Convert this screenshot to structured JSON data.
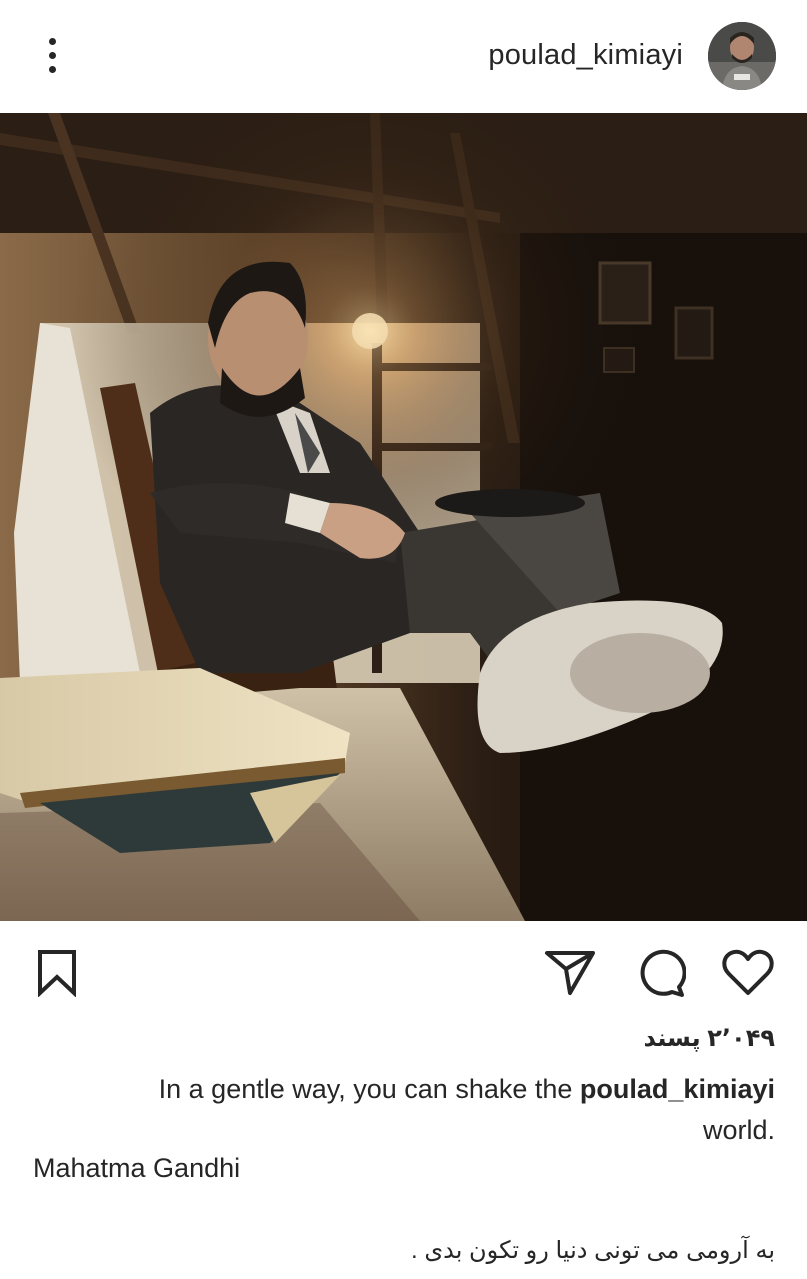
{
  "post": {
    "username": "poulad_kimiayi",
    "likes_text": "۲٬۰۴۹ پسند",
    "caption_before": "In a gentle way, you can shake the ",
    "caption_user": "poulad_kimiayi",
    "caption_after": " world.",
    "attribution": "Mahatma Gandhi",
    "caption_persian": "به آرومی می تونی دنیا رو تکون بدی ."
  },
  "icons": {
    "more": "more-vertical-icon",
    "avatar": "avatar",
    "bookmark": "bookmark-icon",
    "share": "send-icon",
    "comment": "comment-icon",
    "like": "heart-icon"
  },
  "colors": {
    "text": "#262626",
    "background": "#ffffff"
  }
}
